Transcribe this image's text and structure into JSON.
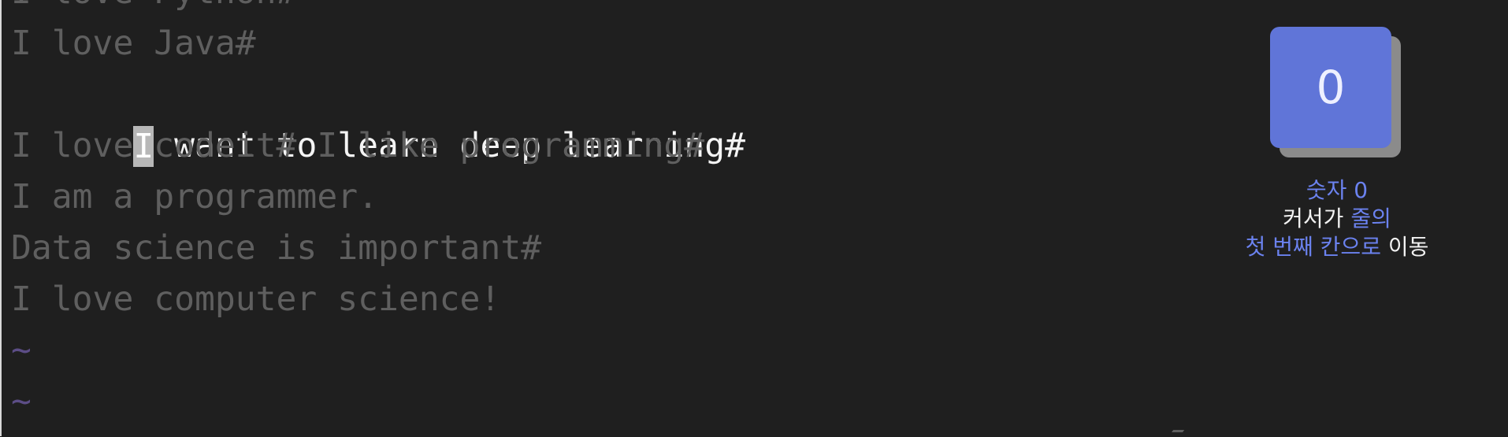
{
  "editor": {
    "lines": [
      "I love Python#",
      "I love Java#",
      "I want to learn deep learning#",
      "I love codeit# I like programming#",
      "I am a programmer.",
      "Data science is important#",
      "I love computer science!",
      "~",
      "~"
    ],
    "active_line": {
      "cursor_char": "I",
      "rest": " want to learn deep learning#"
    },
    "colors": {
      "background": "#1f1f1f",
      "text_dim": "#5f5f5f",
      "text_active": "#f4f4f4",
      "tilde": "#5c4d86",
      "cursor": "#b7b7b7"
    }
  },
  "hint": {
    "key_label": "0",
    "line1_accent": "숫자 0",
    "line2_prefix": "커서가 ",
    "line2_accent": "줄의",
    "line3_accent": "첫 번째 칸으로",
    "line3_suffix": " 이동",
    "colors": {
      "key": "#6075d8",
      "accent": "#6b82ef"
    }
  }
}
